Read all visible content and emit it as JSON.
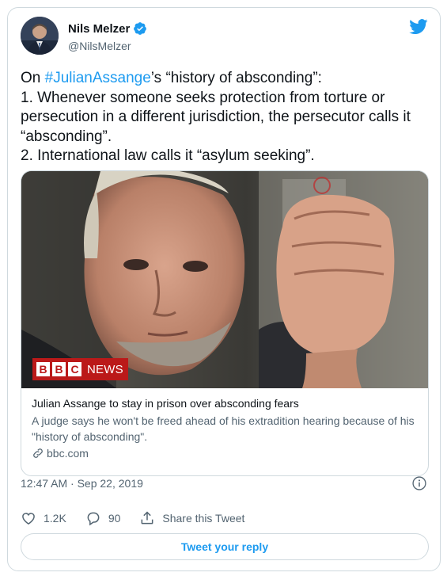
{
  "author": {
    "name": "Nils Melzer",
    "handle": "@NilsMelzer",
    "verified_icon": "verified-badge-icon",
    "avatar_icon": "profile-photo"
  },
  "brand_icon": "twitter-bird-icon",
  "tweet": {
    "text_prefix": "On ",
    "hashtag": "#JulianAssange",
    "text_suffix": "’s “history of absconding”:\n1. Whenever someone seeks protection from torture or persecution in a different jurisdiction, the persecutor calls it “absconding”.\n2. International law calls it “asylum seeking”."
  },
  "link_card": {
    "logo": {
      "letters": [
        "B",
        "B",
        "C"
      ],
      "word": "NEWS"
    },
    "title": "Julian Assange to stay in prison over absconding fears",
    "description": "A judge says he won't be freed ahead of his extradition hearing because of his \"history of absconding\".",
    "domain": "bbc.com"
  },
  "timestamp": "12:47 AM · Sep 22, 2019",
  "actions": {
    "likes": "1.2K",
    "replies": "90",
    "share_label": "Share this Tweet"
  },
  "reply_button": "Tweet your reply",
  "colors": {
    "accent": "#1d9bf0",
    "text": "#0f1419",
    "muted": "#536471",
    "border": "#cfd9de",
    "bbc_red": "#bb1919"
  }
}
